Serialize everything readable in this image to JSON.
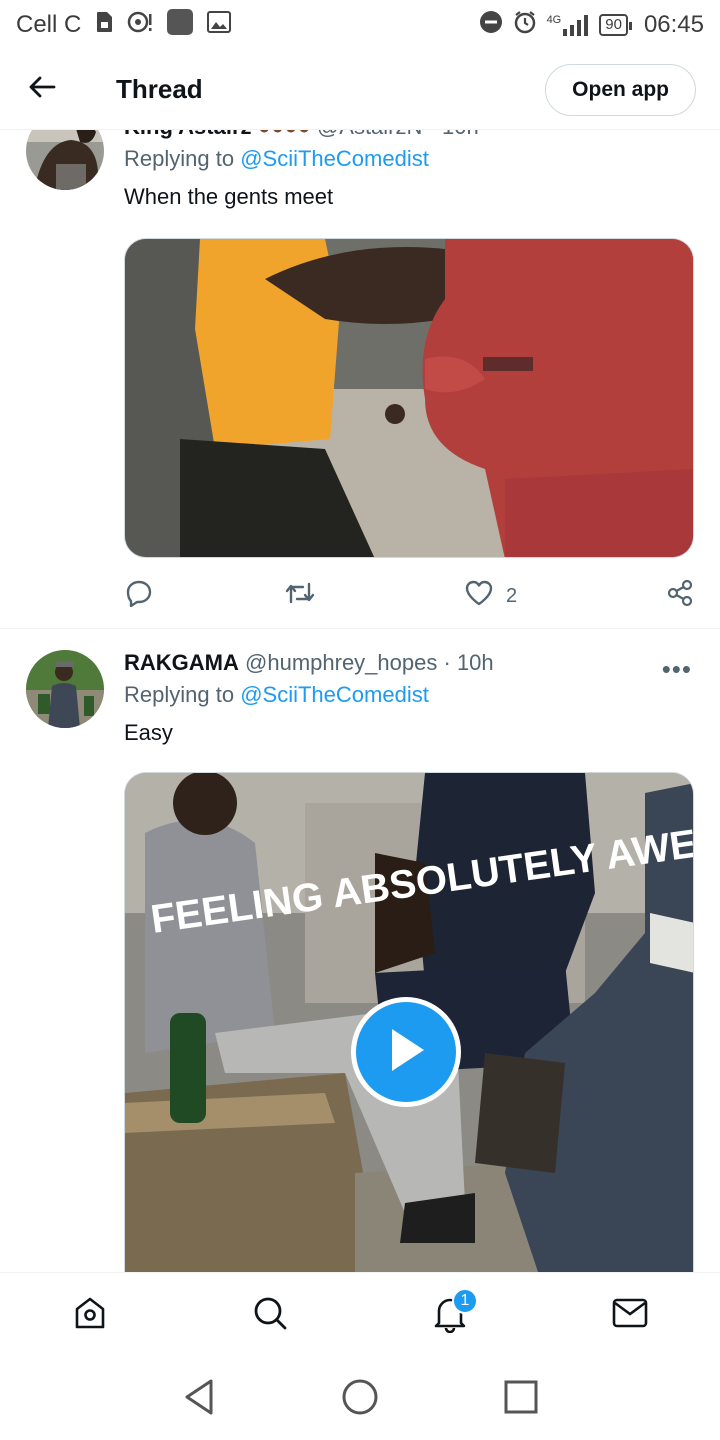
{
  "status_bar": {
    "carrier": "Cell C",
    "network": "4G",
    "battery": "90",
    "time": "06:45"
  },
  "header": {
    "title": "Thread",
    "open_app_label": "Open app"
  },
  "tweets": [
    {
      "display_name": "King Astairz",
      "username": "@AstairzN",
      "time": "10h",
      "replying_prefix": "Replying to",
      "replying_to": "@SciiTheComedist",
      "text": "When the gents meet",
      "replies": "",
      "retweets": "",
      "likes": "2"
    },
    {
      "display_name": "RAKGAMA",
      "username": "@humphrey_hopes",
      "time": "10h",
      "replying_prefix": "Replying to",
      "replying_to": "@SciiTheComedist",
      "text": "Easy",
      "media_overlay": "FEELING ABSOLUTELY AWESOME TODAY"
    }
  ],
  "bottom_nav": {
    "notification_count": "1"
  },
  "icons": {
    "back": "arrow-left-icon",
    "reply": "reply-icon",
    "retweet": "retweet-icon",
    "like": "heart-icon",
    "share": "share-icon",
    "home": "home-icon",
    "search": "search-icon",
    "notifications": "bell-icon",
    "messages": "mail-icon"
  },
  "colors": {
    "accent": "#1d9bf0",
    "secondary_text": "#536471"
  }
}
